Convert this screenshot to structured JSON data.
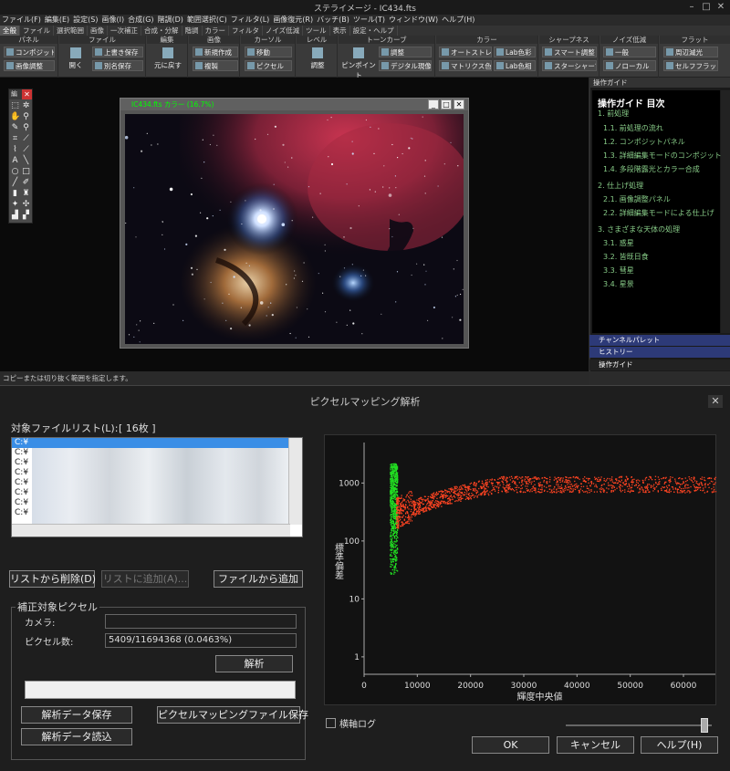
{
  "app": {
    "title": "ステライメージ - IC434.fts",
    "menu": [
      "ファイル(F)",
      "編集(E)",
      "設定(S)",
      "画像(I)",
      "合成(G)",
      "階調(D)",
      "範囲選択(C)",
      "フィルタ(L)",
      "画像復元(R)",
      "バッチ(B)",
      "ツール(T)",
      "ウィンドウ(W)",
      "ヘルプ(H)"
    ],
    "tabs": [
      "全般",
      "ファイル",
      "選択範囲",
      "画像",
      "一次補正",
      "合成・分解",
      "階調",
      "カラー",
      "フィルタ",
      "ノイズ低減",
      "ツール",
      "表示",
      "設定・ヘルプ"
    ],
    "ribbon": {
      "panel": {
        "title": "パネル",
        "btn1": "コンポジット",
        "btn2": "画像調整"
      },
      "file": {
        "title": "ファイル",
        "open": "開く",
        "overwrite": "上書き保存",
        "saveas": "別名保存"
      },
      "edit": {
        "title": "編集",
        "undo": "元に戻す"
      },
      "image": {
        "title": "画像",
        "new": "新規作成",
        "dup": "複製"
      },
      "cursor": {
        "title": "カーソル",
        "move": "移動",
        "pixel": "ピクセル"
      },
      "level": {
        "title": "レベル",
        "adjust": "調整"
      },
      "tone": {
        "title": "トーンカーブ",
        "point": "ピンポイント",
        "adjust": "調整",
        "digital": "デジタル現像"
      },
      "color": {
        "title": "カラー",
        "auto": "オートストレッチ",
        "lab": "Lab色彩",
        "matrix": "マトリクス色彩",
        "labhue": "Lab色相"
      },
      "sharp": {
        "title": "シャープネス",
        "smart": "スマート調整",
        "star": "スターシャープ"
      },
      "noise": {
        "title": "ノイズ低減",
        "general": "一般",
        "normal": "ノローカル"
      },
      "flat": {
        "title": "フラット",
        "vignette": "周辺減光",
        "self": "セルフフラット"
      }
    },
    "toolbox_label": "編",
    "image_window_title": "IC434.fts カラー (16.7%)",
    "guide": {
      "header": "操作ガイド",
      "title": "操作ガイド 目次",
      "items": [
        "1. 前処理",
        "1.1. 前処理の流れ",
        "1.2. コンポジットパネル",
        "1.3. 詳細編集モードのコンポジット",
        "1.4. 多段階露光とカラー合成",
        "2. 仕上げ処理",
        "2.1. 画像調整パネル",
        "2.2. 詳細編集モードによる仕上げ",
        "3. さまざまな天体の処理",
        "3.1. 惑星",
        "3.2. 皆既日食",
        "3.3. 彗星",
        "3.4. 星景"
      ]
    },
    "panels": [
      "チャンネルパレット",
      "ヒストリー",
      "操作ガイド"
    ],
    "status": "コピーまたは切り抜く範囲を指定します。"
  },
  "dialog": {
    "title": "ピクセルマッピング解析",
    "file_list_label": "対象ファイルリスト(L):",
    "file_count": "[ 16枚 ]",
    "files": [
      "C:¥",
      "C:¥",
      "C:¥",
      "C:¥",
      "C:¥",
      "C:¥",
      "C:¥",
      "C:¥"
    ],
    "btn_remove": "リストから削除(D)",
    "btn_add": "リストに追加(A)...",
    "btn_add_file": "ファイルから追加",
    "group_label": "補正対象ピクセル",
    "camera_label": "カメラ:",
    "camera_value": "",
    "pixels_label": "ピクセル数:",
    "pixels_value": "5409/11694368 (0.0463%)",
    "btn_analyze": "解析",
    "btn_save_data": "解析データ保存",
    "btn_save_map": "ピクセルマッピングファイル保存",
    "btn_load_data": "解析データ読込",
    "log_axis_label": "横軸ログ",
    "btn_ok": "OK",
    "btn_cancel": "キャンセル",
    "btn_help": "ヘルプ(H)"
  },
  "chart_data": {
    "type": "scatter",
    "xlabel": "輝度中央値",
    "ylabel": "標準偏差",
    "x_ticks": [
      0,
      10000,
      20000,
      30000,
      40000,
      50000,
      60000
    ],
    "y_ticks": [
      1,
      10,
      100,
      1000
    ],
    "y_scale": "log",
    "xlim": [
      0,
      66000
    ],
    "ylim": [
      0.5,
      5000
    ],
    "series": [
      {
        "color": "#22dd22",
        "x_range": [
          4800,
          6200
        ],
        "y_range": [
          25,
          2200
        ]
      },
      {
        "color": "#ff4422",
        "x_range": [
          6000,
          66000
        ],
        "y_range": [
          120,
          1600
        ]
      }
    ]
  }
}
